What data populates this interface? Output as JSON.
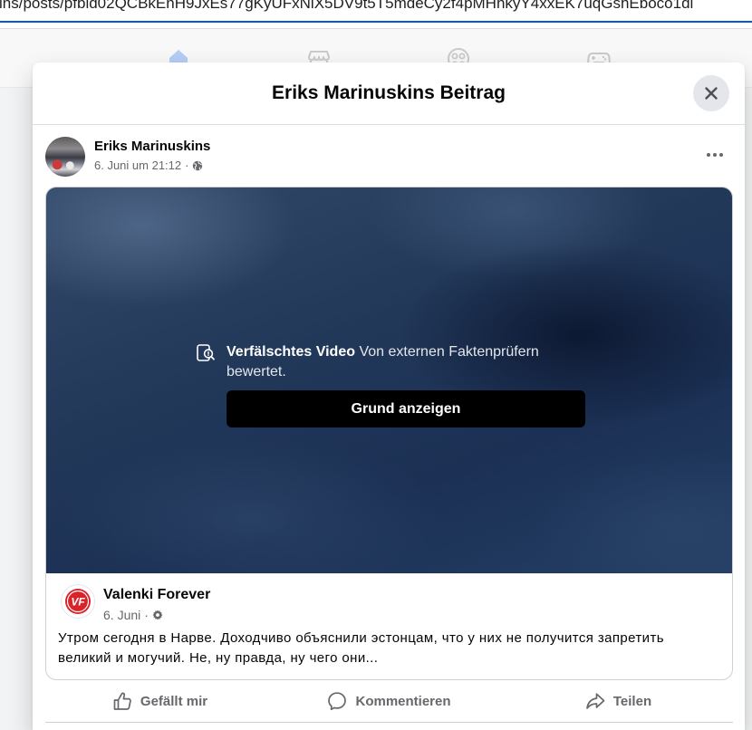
{
  "browser": {
    "url": "ins/posts/pfbid02QCBkEnH9JxEs77gKyUFxNiX5DV9t5T5mdeCy2f4pMHhkyY4xxEK7uqGshEboco1dl"
  },
  "nav": {
    "items": [
      {
        "icon": "home-icon",
        "active": true
      },
      {
        "icon": "marketplace-icon",
        "active": false
      },
      {
        "icon": "groups-icon",
        "active": false
      },
      {
        "icon": "gaming-icon",
        "active": false
      }
    ]
  },
  "modal": {
    "title": "Eriks Marinuskins Beitrag",
    "close_icon": "close-icon"
  },
  "post": {
    "author": "Eriks Marinuskins",
    "timestamp": "6. Juni um 21:12",
    "separator": "·",
    "audience_icon": "globe-icon",
    "more_icon": "more-icon"
  },
  "shared": {
    "warning_icon": "fact-check-icon",
    "warning_title": "Verfälschtes Video",
    "warning_text": "Von externen Faktenprüfern bewertet.",
    "reveal_button": "Grund anzeigen",
    "page": {
      "name": "Valenki Forever",
      "logo_text": "VF",
      "date": "6. Juni",
      "separator": "·",
      "audience_icon": "settings-icon"
    },
    "text": "Утром сегодня в Нарве. Доходчиво объяснили эстонцам, что у них не получится запретить великий и могучий. Не, ну правда, ну чего они..."
  },
  "actions": [
    {
      "label": "Gefällt mir",
      "icon": "like-icon"
    },
    {
      "label": "Kommentieren",
      "icon": "comment-icon"
    },
    {
      "label": "Teilen",
      "icon": "share-icon"
    }
  ],
  "colors": {
    "accent": "#0866ff",
    "text_primary": "#050505",
    "text_secondary": "#65676b",
    "reveal_button": "#000000",
    "close_button_bg": "#e4e6eb",
    "logo_red": "#d8232a",
    "focus_line": "#0b57d0"
  }
}
